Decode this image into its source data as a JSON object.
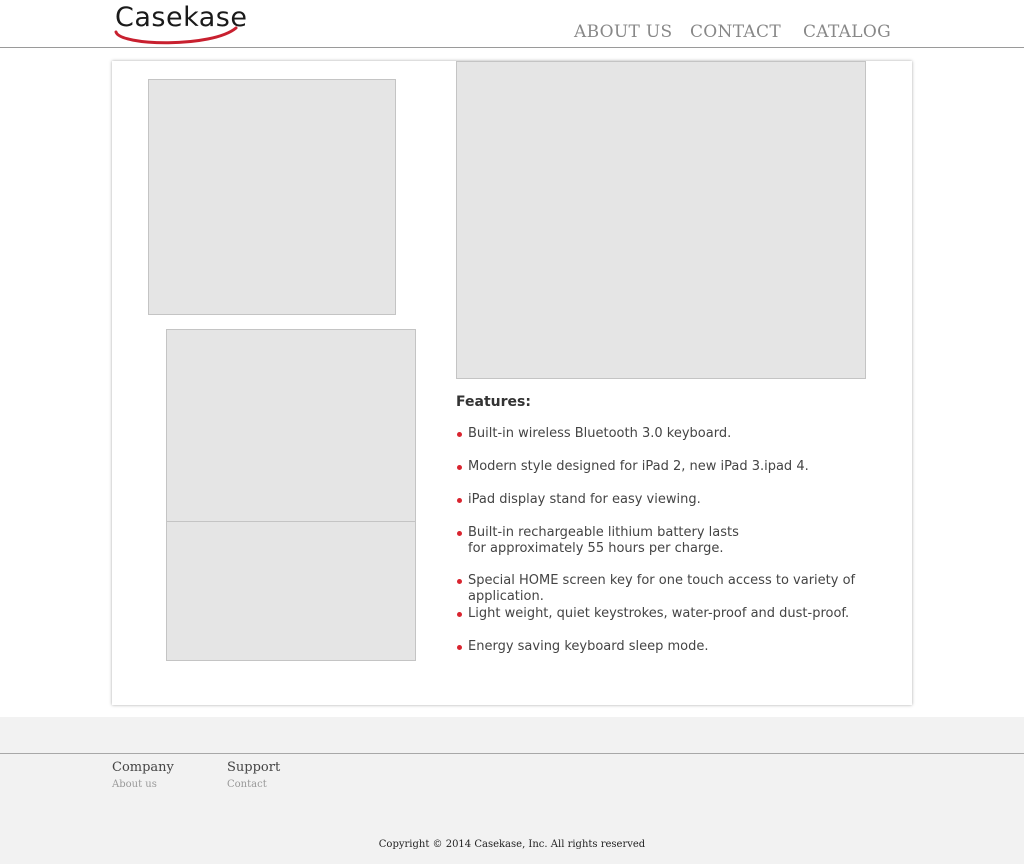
{
  "brand": {
    "name": "Casekase",
    "accent": "#c8202f"
  },
  "nav": {
    "about": "ABOUT US",
    "contact": "CONTACT",
    "catalog": "CATALOG"
  },
  "product": {
    "features_title": "Features:",
    "bullet_color": "#d9242f",
    "features": [
      "Built-in wireless Bluetooth 3.0 keyboard.",
      "Modern style designed for iPad 2, new iPad 3.ipad 4.",
      "iPad display stand for easy viewing.",
      "Built-in rechargeable lithium battery lasts for approximately 55 hours per charge.",
      "Special HOME screen key for one touch access to variety of application.",
      "Light weight, quiet keystrokes, water-proof and dust-proof.",
      "Energy saving keyboard sleep mode."
    ]
  },
  "footer": {
    "company_heading": "Company",
    "company_link": "About us",
    "support_heading": "Support",
    "support_link": "Contact",
    "copyright": "Copyright © 2014 Casekase, Inc. All rights reserved"
  }
}
